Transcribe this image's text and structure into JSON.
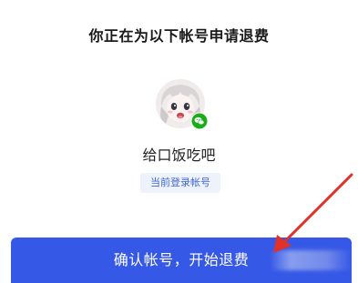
{
  "header": {
    "title": "你正在为以下帐号申请退费"
  },
  "account": {
    "avatar_icon": "anime-avatar",
    "badge_icon": "wechat-icon",
    "nickname": "给口饭吃吧",
    "tag": "当前登录帐号"
  },
  "action": {
    "confirm_label": "确认帐号，开始退费"
  },
  "colors": {
    "primary": "#3558e6",
    "tag_text": "#3d67d6",
    "tag_bg": "#eef2fb",
    "wechat_green": "#1aad19",
    "annotation_arrow": "#e0312a"
  }
}
